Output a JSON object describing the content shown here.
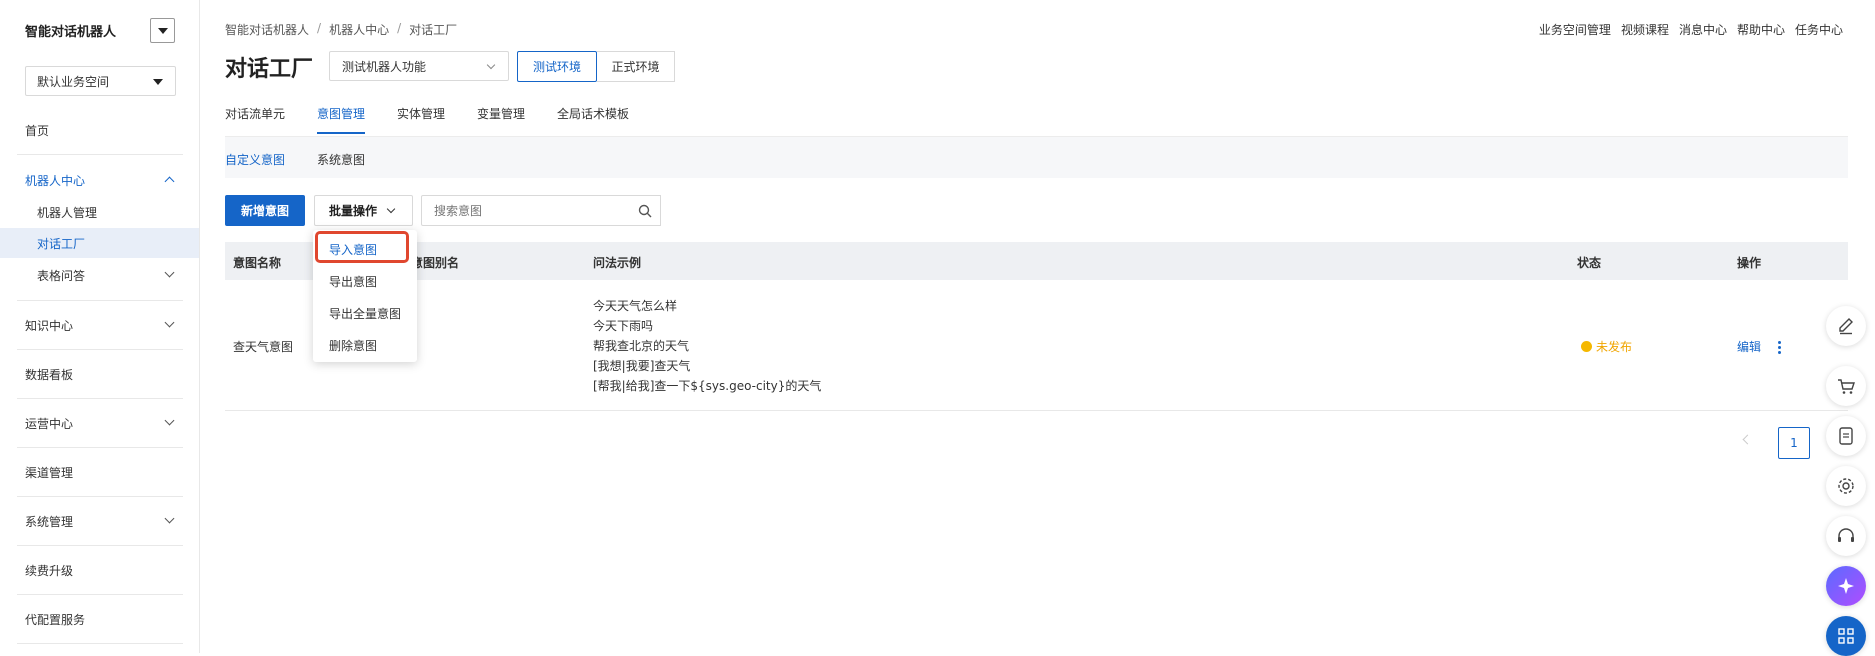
{
  "app": {
    "title": "智能对话机器人",
    "workspace": "默认业务空间"
  },
  "sidebar": {
    "items": [
      {
        "label": "首页"
      },
      {
        "label": "机器人中心"
      },
      {
        "label": "机器人管理"
      },
      {
        "label": "对话工厂"
      },
      {
        "label": "表格问答"
      },
      {
        "label": "知识中心"
      },
      {
        "label": "数据看板"
      },
      {
        "label": "运营中心"
      },
      {
        "label": "渠道管理"
      },
      {
        "label": "系统管理"
      },
      {
        "label": "续费升级"
      },
      {
        "label": "代配置服务"
      }
    ]
  },
  "breadcrumb": [
    "智能对话机器人",
    "机器人中心",
    "对话工厂"
  ],
  "breadcrumb_sep": "/",
  "top_links": [
    "业务空间管理",
    "视频课程",
    "消息中心",
    "帮助中心",
    "任务中心"
  ],
  "page": {
    "title": "对话工厂",
    "bot_select": "测试机器人功能",
    "env_test": "测试环境",
    "env_prod": "正式环境"
  },
  "tabs": [
    "对话流单元",
    "意图管理",
    "实体管理",
    "变量管理",
    "全局话术模板"
  ],
  "subtabs": [
    "自定义意图",
    "系统意图"
  ],
  "toolbar": {
    "add_label": "新增意图",
    "batch_label": "批量操作",
    "search_placeholder": "搜索意图"
  },
  "dropdown": {
    "items": [
      "导入意图",
      "导出意图",
      "导出全量意图",
      "删除意图"
    ]
  },
  "table": {
    "headers": [
      "意图名称",
      "意图别名",
      "问法示例",
      "状态",
      "操作"
    ],
    "rows": [
      {
        "name": "查天气意图",
        "examples": [
          "今天天气怎么样",
          "今天下雨吗",
          "帮我查北京的天气",
          "[我想|我要]查天气",
          "[帮我|给我]查一下${sys.geo-city}的天气"
        ],
        "status": "未发布",
        "edit": "编辑"
      }
    ]
  },
  "pagination": {
    "current": "1"
  },
  "colors": {
    "accent": "#1565c8",
    "status_unpublished": "#f5b800",
    "highlight": "#e0472f"
  },
  "float_icons": [
    "edit-icon",
    "cart-icon",
    "app-icon",
    "settings-icon",
    "headset-icon",
    "ai-assistant-icon",
    "apps-grid-icon"
  ]
}
